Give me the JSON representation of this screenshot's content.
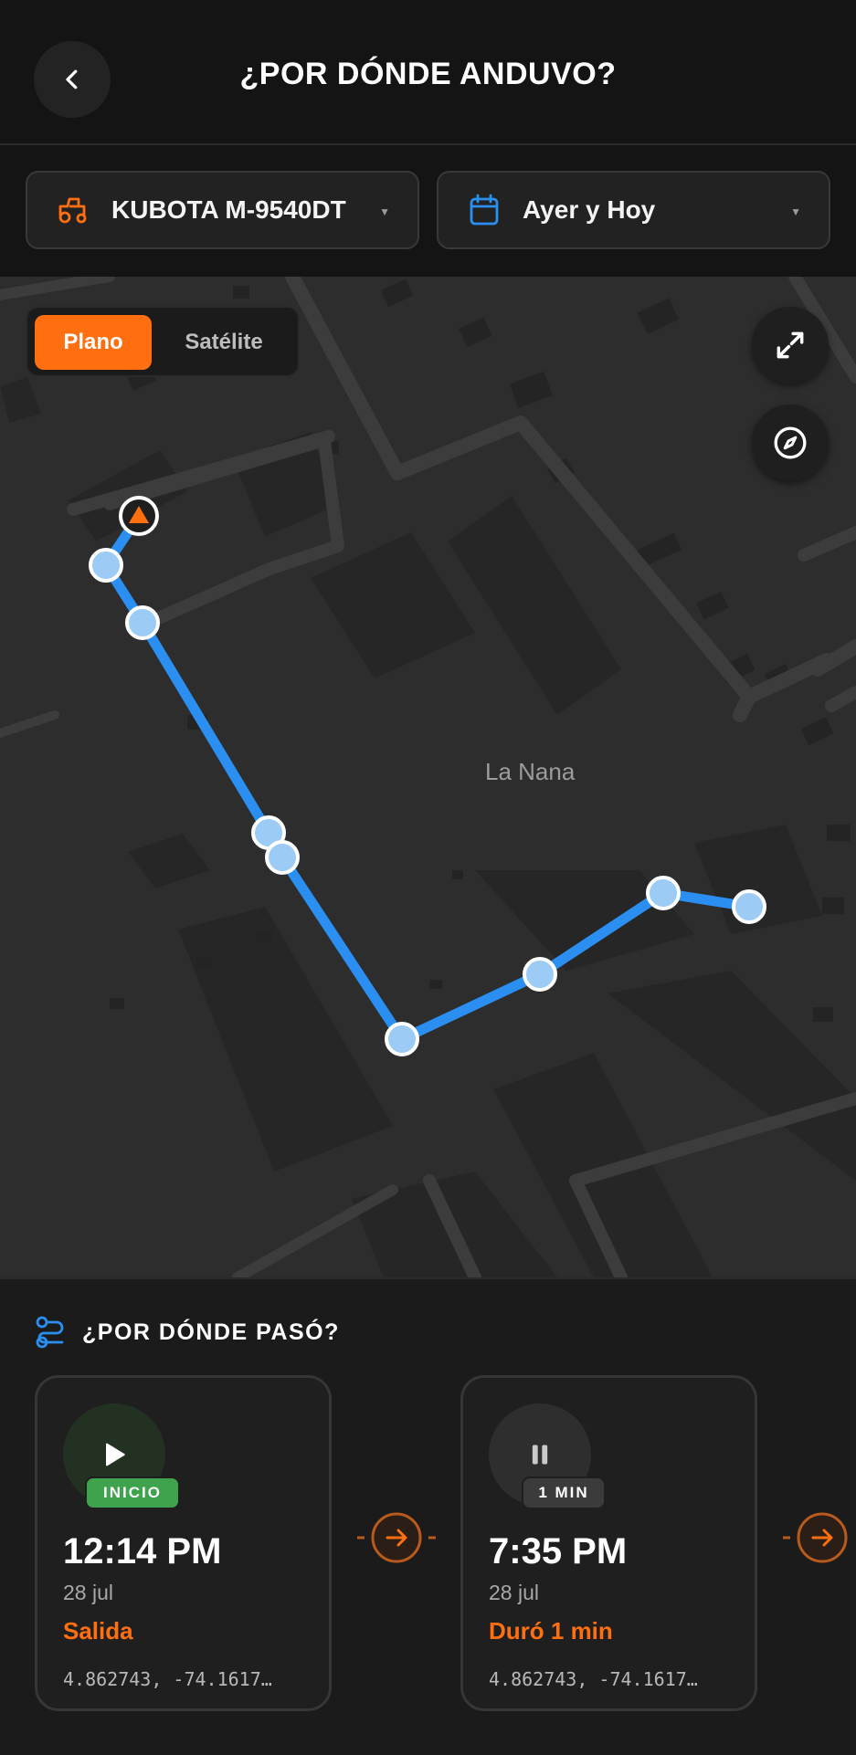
{
  "header": {
    "title": "¿POR DÓNDE ANDUVO?",
    "back_icon": "chevron-left-icon"
  },
  "filters": {
    "vehicle": {
      "label": "KUBOTA M-9540DT",
      "icon": "tractor-icon"
    },
    "date_range": {
      "label": "Ayer y Hoy",
      "icon": "calendar-icon"
    }
  },
  "map": {
    "view_toggle": {
      "options": [
        "Plano",
        "Satélite"
      ],
      "selected": "Plano"
    },
    "place_label": "La Nana",
    "controls": [
      "expand-icon",
      "compass-icon"
    ],
    "colors": {
      "route": "#2a8ff0",
      "point": "#9ccbf6",
      "accent": "#ff6f0f"
    }
  },
  "stops_panel": {
    "title": "¿POR DÓNDE PASÓ?",
    "stops": [
      {
        "badge": "INICIO",
        "time": "12:14 PM",
        "date": "28 jul",
        "status": "Salida",
        "coords": "4.862743, -74.1617…",
        "icon": "play-icon"
      },
      {
        "badge": "1 MIN",
        "time": "7:35 PM",
        "date": "28 jul",
        "status": "Duró 1 min",
        "coords": "4.862743, -74.1617…",
        "icon": "pause-icon"
      }
    ]
  }
}
